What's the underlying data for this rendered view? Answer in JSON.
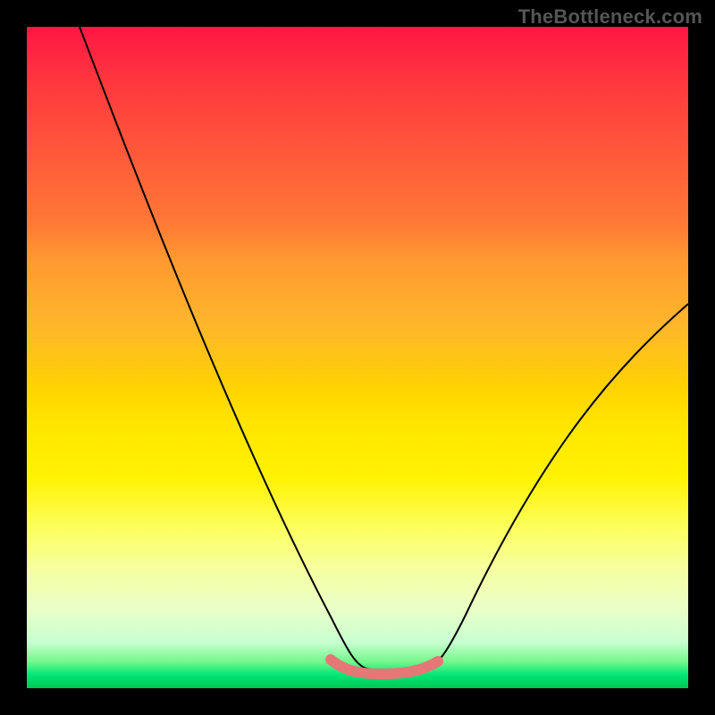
{
  "attribution": "TheBottleneck.com",
  "chart_data": {
    "type": "line",
    "title": "",
    "xlabel": "",
    "ylabel": "",
    "xlim": [
      0,
      100
    ],
    "ylim": [
      0,
      100
    ],
    "series": [
      {
        "name": "bottleneck-curve",
        "x": [
          8,
          15,
          22,
          30,
          38,
          45,
          49,
          52,
          55,
          58,
          62,
          70,
          78,
          86,
          94,
          100
        ],
        "values": [
          100,
          85,
          70,
          55,
          38,
          22,
          10,
          3,
          2,
          3,
          10,
          25,
          40,
          49,
          54,
          58
        ]
      }
    ],
    "annotations": [
      {
        "name": "optimal-range",
        "x_start": 49,
        "x_end": 62,
        "y": 3
      }
    ],
    "gradient_stops": [
      {
        "pos": 0,
        "color": "#ff1744"
      },
      {
        "pos": 50,
        "color": "#ffd400"
      },
      {
        "pos": 100,
        "color": "#00c853"
      }
    ]
  }
}
